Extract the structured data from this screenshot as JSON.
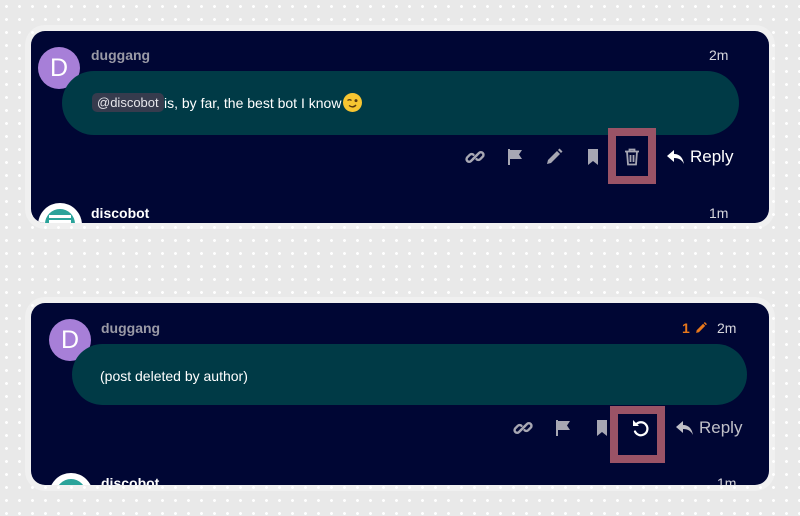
{
  "post1": {
    "avatar_letter": "D",
    "username": "duggang",
    "time": "2m",
    "mention": "@discobot",
    "body": "is, by far, the best bot I know",
    "reply_label": "Reply"
  },
  "reply1": {
    "username": "discobot",
    "time": "1m"
  },
  "post2": {
    "avatar_letter": "D",
    "username": "duggang",
    "edit_count": "1",
    "time": "2m",
    "body": "(post deleted by author)",
    "reply_label": "Reply"
  },
  "reply2": {
    "username": "discobot",
    "time": "1m"
  },
  "colors": {
    "card_bg": "#000634",
    "bubble_bg": "#003a46",
    "avatar_bg": "#a77fd8",
    "highlight": "#9a5366",
    "edit_accent": "#e9781b"
  }
}
